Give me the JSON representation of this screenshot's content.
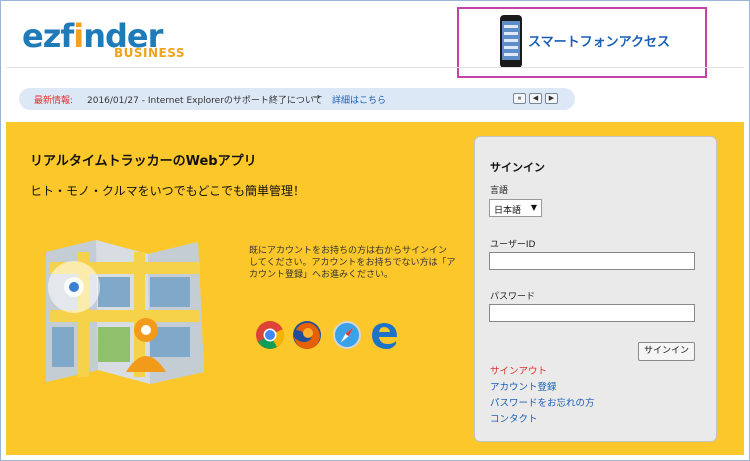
{
  "header": {
    "logo_main_prefix": "ezf",
    "logo_main_accent": "i",
    "logo_main_suffix": "nder",
    "logo_sub": "BUSINESS",
    "smartphone_link": "スマートフォンアクセス"
  },
  "news": {
    "label": "最新情報:",
    "text": "2016/01/27 - Internet Explorerのサポート終了について",
    "arrow": "→",
    "link": "詳細はこちら",
    "controls": [
      "⏸",
      "◀",
      "▶"
    ]
  },
  "main": {
    "title": "リアルタイムトラッカーのWebアプリ",
    "subtitle": "ヒト・モノ・クルマをいつでもどこでも簡単管理！",
    "account_text": "既にアカウントをお持ちの方は右からサインインしてください。アカウントをお持ちでない方は「アカウント登録」へお進みください。",
    "browsers": [
      "chrome-icon",
      "firefox-icon",
      "safari-icon",
      "edge-icon"
    ]
  },
  "signin": {
    "title": "サインイン",
    "language_label": "言語",
    "language_value": "日本語",
    "language_caret": "▼",
    "user_label": "ユーザーID",
    "user_value": "",
    "password_label": "パスワード",
    "password_value": "",
    "button": "サインイン",
    "links": {
      "signout": "サインアウト",
      "register": "アカウント登録",
      "forgot": "パスワードをお忘れの方",
      "contact": "コンタクト"
    }
  },
  "colors": {
    "brand_blue": "#1f7ab8",
    "brand_orange": "#f0a31b",
    "background_gold": "#fbc72a",
    "highlight_magenta": "#c642a8",
    "link_blue": "#1a5fb4",
    "alert_red": "#e0322b"
  }
}
